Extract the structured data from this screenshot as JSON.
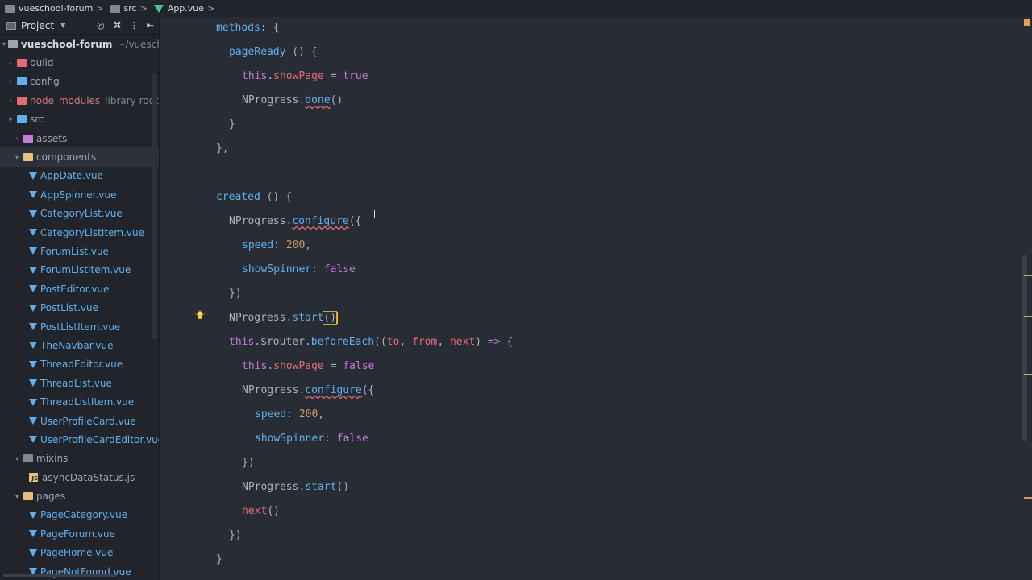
{
  "breadcrumb": [
    "vueschool-forum",
    "src",
    "App.vue"
  ],
  "project_panel": {
    "title": "Project",
    "tree": [
      {
        "label": "vueschool-forum",
        "extra": "~/vueschc",
        "type": "root",
        "level": 0,
        "open": true
      },
      {
        "label": "build",
        "type": "folder-red",
        "level": 1,
        "open": false
      },
      {
        "label": "config",
        "type": "folder-blue",
        "level": 1,
        "open": false
      },
      {
        "label": "node_modules",
        "extra": "library root",
        "type": "folder-red",
        "level": 1,
        "open": false,
        "module": true
      },
      {
        "label": "src",
        "type": "folder-blue",
        "level": 1,
        "open": true
      },
      {
        "label": "assets",
        "type": "folder-purple",
        "level": 2,
        "open": false
      },
      {
        "label": "components",
        "type": "folder-yellow",
        "level": 2,
        "open": true,
        "selected": true
      },
      {
        "label": "AppDate.vue",
        "type": "vue",
        "level": 3
      },
      {
        "label": "AppSpinner.vue",
        "type": "vue",
        "level": 3
      },
      {
        "label": "CategoryList.vue",
        "type": "vue",
        "level": 3
      },
      {
        "label": "CategoryListItem.vue",
        "type": "vue",
        "level": 3
      },
      {
        "label": "ForumList.vue",
        "type": "vue",
        "level": 3
      },
      {
        "label": "ForumListItem.vue",
        "type": "vue",
        "level": 3
      },
      {
        "label": "PostEditor.vue",
        "type": "vue",
        "level": 3
      },
      {
        "label": "PostList.vue",
        "type": "vue",
        "level": 3
      },
      {
        "label": "PostListItem.vue",
        "type": "vue",
        "level": 3
      },
      {
        "label": "TheNavbar.vue",
        "type": "vue",
        "level": 3
      },
      {
        "label": "ThreadEditor.vue",
        "type": "vue",
        "level": 3
      },
      {
        "label": "ThreadList.vue",
        "type": "vue",
        "level": 3
      },
      {
        "label": "ThreadListItem.vue",
        "type": "vue",
        "level": 3
      },
      {
        "label": "UserProfileCard.vue",
        "type": "vue",
        "level": 3
      },
      {
        "label": "UserProfileCardEditor.vue",
        "type": "vue",
        "level": 3
      },
      {
        "label": "mixins",
        "type": "folder-gray",
        "level": 2,
        "open": true
      },
      {
        "label": "asyncDataStatus.js",
        "type": "js",
        "level": 3
      },
      {
        "label": "pages",
        "type": "folder-yellow",
        "level": 2,
        "open": true
      },
      {
        "label": "PageCategory.vue",
        "type": "vue",
        "level": 3
      },
      {
        "label": "PageForum.vue",
        "type": "vue",
        "level": 3
      },
      {
        "label": "PageHome.vue",
        "type": "vue",
        "level": 3
      },
      {
        "label": "PageNotFound.vue",
        "type": "vue",
        "level": 3
      }
    ]
  },
  "editor": {
    "file": "App.vue",
    "lines": [
      {
        "indent": 0,
        "tokens": [
          [
            "f",
            "methods"
          ],
          [
            "",
            ": {"
          ]
        ]
      },
      {
        "indent": 1,
        "tokens": [
          [
            "f",
            "pageReady"
          ],
          [
            "",
            " () {"
          ]
        ]
      },
      {
        "indent": 2,
        "tokens": [
          [
            "k",
            "this"
          ],
          [
            "",
            "."
          ],
          [
            "p",
            "showPage"
          ],
          [
            "",
            " = "
          ],
          [
            "k",
            "true"
          ]
        ]
      },
      {
        "indent": 2,
        "tokens": [
          [
            "",
            "NProgress."
          ],
          [
            "fu",
            "done"
          ],
          [
            "",
            "()"
          ]
        ]
      },
      {
        "indent": 1,
        "tokens": [
          [
            "",
            "}"
          ]
        ]
      },
      {
        "indent": 0,
        "tokens": [
          [
            "",
            "},"
          ]
        ]
      },
      {
        "indent": 0,
        "tokens": []
      },
      {
        "indent": 0,
        "tokens": [
          [
            "f",
            "created"
          ],
          [
            "",
            " () {"
          ]
        ]
      },
      {
        "indent": 1,
        "tokens": [
          [
            "",
            "NProgress."
          ],
          [
            "fu",
            "configure"
          ],
          [
            "",
            "({"
          ]
        ]
      },
      {
        "indent": 2,
        "tokens": [
          [
            "f",
            "speed"
          ],
          [
            "",
            ": "
          ],
          [
            "n",
            "200"
          ],
          [
            "",
            ","
          ]
        ]
      },
      {
        "indent": 2,
        "tokens": [
          [
            "f",
            "showSpinner"
          ],
          [
            "",
            ": "
          ],
          [
            "k",
            "false"
          ]
        ]
      },
      {
        "indent": 1,
        "tokens": [
          [
            "",
            "})"
          ]
        ]
      },
      {
        "indent": 1,
        "tokens": [
          [
            "",
            "NProgress."
          ],
          [
            "f",
            "start"
          ],
          [
            "hl",
            "()"
          ]
        ],
        "cursor": true,
        "bulb": true
      },
      {
        "indent": 1,
        "tokens": [
          [
            "k",
            "this"
          ],
          [
            "",
            ".$router."
          ],
          [
            "f",
            "beforeEach"
          ],
          [
            "",
            "(("
          ],
          [
            "p",
            "to"
          ],
          [
            "",
            ", "
          ],
          [
            "p",
            "from"
          ],
          [
            "",
            ", "
          ],
          [
            "p",
            "next"
          ],
          [
            "",
            ") "
          ],
          [
            "k",
            "=>"
          ],
          [
            "",
            " {"
          ]
        ]
      },
      {
        "indent": 2,
        "tokens": [
          [
            "k",
            "this"
          ],
          [
            "",
            "."
          ],
          [
            "p",
            "showPage"
          ],
          [
            "",
            " = "
          ],
          [
            "k",
            "false"
          ]
        ]
      },
      {
        "indent": 2,
        "tokens": [
          [
            "",
            "NProgress."
          ],
          [
            "fu",
            "configure"
          ],
          [
            "",
            "({"
          ]
        ]
      },
      {
        "indent": 3,
        "tokens": [
          [
            "f",
            "speed"
          ],
          [
            "",
            ": "
          ],
          [
            "n",
            "200"
          ],
          [
            "",
            ","
          ]
        ]
      },
      {
        "indent": 3,
        "tokens": [
          [
            "f",
            "showSpinner"
          ],
          [
            "",
            ": "
          ],
          [
            "k",
            "false"
          ]
        ]
      },
      {
        "indent": 2,
        "tokens": [
          [
            "",
            "})"
          ]
        ]
      },
      {
        "indent": 2,
        "tokens": [
          [
            "",
            "NProgress."
          ],
          [
            "f",
            "start"
          ],
          [
            "",
            "()"
          ]
        ]
      },
      {
        "indent": 2,
        "tokens": [
          [
            "p",
            "next"
          ],
          [
            "",
            "()"
          ]
        ]
      },
      {
        "indent": 1,
        "tokens": [
          [
            "",
            "})"
          ]
        ]
      },
      {
        "indent": 0,
        "tokens": [
          [
            "",
            "}"
          ]
        ]
      }
    ]
  },
  "colors": {
    "background": "#282c34",
    "sidebar": "#21252b",
    "keyword": "#c678dd",
    "function": "#61afef",
    "property": "#e06c75",
    "number": "#d19a66",
    "warning": "#e5a153"
  }
}
